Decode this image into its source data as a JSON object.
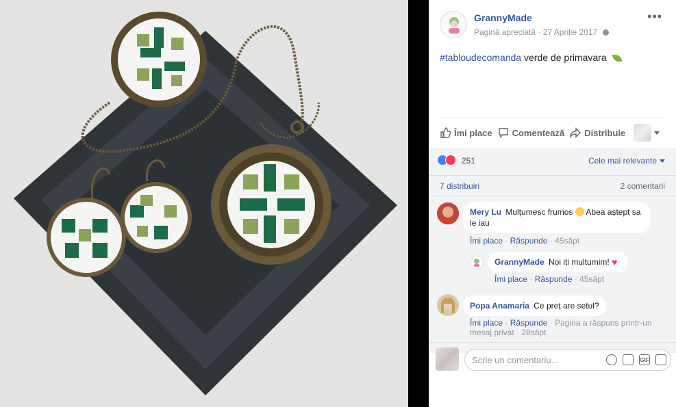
{
  "post": {
    "page_name": "GrannyMade",
    "status": "Pagină apreciată",
    "date": "27 Aprilie 2017",
    "more_icon": "more-horizontal-icon",
    "text_hashtag": "#tabloudecomanda",
    "text_body": "verde de primavara"
  },
  "actions": {
    "like": "Îmi place",
    "comment": "Comentează",
    "share": "Distribuie"
  },
  "stats": {
    "reaction_count": "251",
    "sort_label": "Cele mai relevante",
    "shares": "7 distribuiri",
    "comments": "2 comentarii"
  },
  "comments": [
    {
      "author": "Mery Lu",
      "text_before": "Mulțumesc frumos",
      "text_after": "Abea aștept sa le iau",
      "like": "Îmi place",
      "reply": "Răspunde",
      "time": "45săpt"
    },
    {
      "author": "GrannyMade",
      "text": "Noi iti multumim!",
      "like": "Îmi place",
      "reply": "Răspunde",
      "time": "45săpt"
    },
    {
      "author": "Popa Anamaria",
      "text": "Ce preț are setul?",
      "like": "Îmi place",
      "reply": "Răspunde",
      "note": "Pagina a răspuns printr-un mesaj privat",
      "time": "28săpt"
    }
  ],
  "composer": {
    "placeholder": "Scrie un comentariu..."
  },
  "colors": {
    "link": "#365899",
    "muted": "#90949c",
    "panel_grey": "#f2f3f5",
    "like_blue": "#4a7ff0",
    "love_red": "#f33e58"
  }
}
